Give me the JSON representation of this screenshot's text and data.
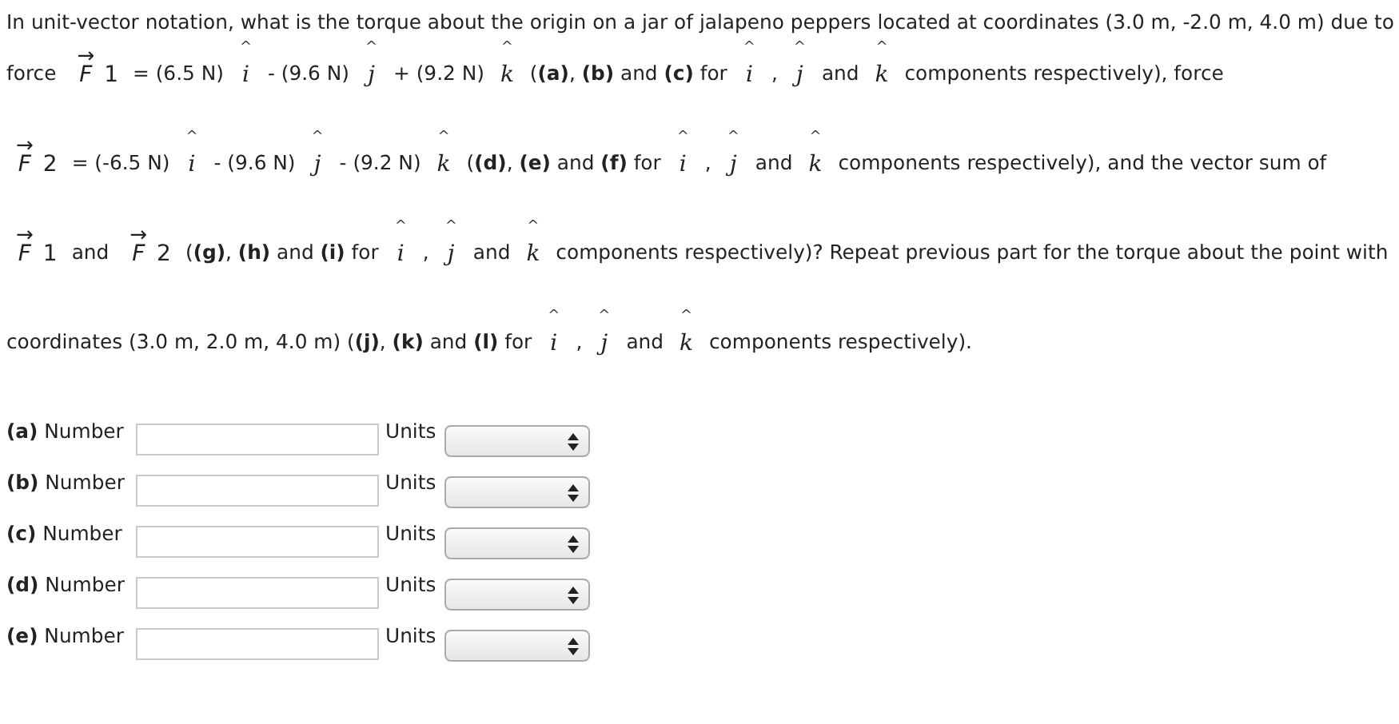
{
  "question": {
    "lines": [
      [
        {
          "kind": "text",
          "text": "In unit-vector notation, what is the torque about the origin on a jar of jalapeno peppers located at coordinates (3.0 m, -2.0 m, 4.0 m) due to"
        }
      ],
      [
        {
          "kind": "text",
          "text": "force"
        },
        {
          "kind": "vector",
          "arrow": "→",
          "symbol": "F",
          "index": "1"
        },
        {
          "kind": "text",
          "text": "= (6.5 N)"
        },
        {
          "kind": "unit_vector",
          "hat": "^",
          "symbol": "i"
        },
        {
          "kind": "text",
          "text": "- (9.6 N)"
        },
        {
          "kind": "unit_vector",
          "hat": "^",
          "symbol": "j"
        },
        {
          "kind": "text",
          "text": "+ (9.2 N)"
        },
        {
          "kind": "unit_vector",
          "hat": "^",
          "symbol": "k"
        },
        {
          "kind": "text",
          "text": "(**(a)**, **(b)** and **(c)** for"
        },
        {
          "kind": "unit_vector",
          "hat": "^",
          "symbol": "i"
        },
        {
          "kind": "text",
          "text": ","
        },
        {
          "kind": "unit_vector",
          "hat": "^",
          "symbol": "j"
        },
        {
          "kind": "text",
          "text": "and"
        },
        {
          "kind": "unit_vector",
          "hat": "^",
          "symbol": "k"
        },
        {
          "kind": "text",
          "text": "components respectively), force"
        }
      ],
      [
        {
          "kind": "vector",
          "arrow": "→",
          "symbol": "F",
          "index": "2"
        },
        {
          "kind": "text",
          "text": "= (-6.5 N)"
        },
        {
          "kind": "unit_vector",
          "hat": "^",
          "symbol": "i"
        },
        {
          "kind": "text",
          "text": "- (9.6 N)"
        },
        {
          "kind": "unit_vector",
          "hat": "^",
          "symbol": "j"
        },
        {
          "kind": "text",
          "text": "- (9.2 N)"
        },
        {
          "kind": "unit_vector",
          "hat": "^",
          "symbol": "k"
        },
        {
          "kind": "text",
          "text": "(**(d)**, **(e)** and **(f)** for"
        },
        {
          "kind": "unit_vector",
          "hat": "^",
          "symbol": "i"
        },
        {
          "kind": "text",
          "text": ","
        },
        {
          "kind": "unit_vector",
          "hat": "^",
          "symbol": "j"
        },
        {
          "kind": "text",
          "text": "and"
        },
        {
          "kind": "unit_vector",
          "hat": "^",
          "symbol": "k"
        },
        {
          "kind": "text",
          "text": "components respectively), and the vector sum of"
        }
      ],
      [
        {
          "kind": "vector",
          "arrow": "→",
          "symbol": "F",
          "index": "1"
        },
        {
          "kind": "text",
          "text": "and"
        },
        {
          "kind": "vector",
          "arrow": "→",
          "symbol": "F",
          "index": "2"
        },
        {
          "kind": "text",
          "text": "(**(g)**, **(h)** and **(i)** for"
        },
        {
          "kind": "unit_vector",
          "hat": "^",
          "symbol": "i"
        },
        {
          "kind": "text",
          "text": ","
        },
        {
          "kind": "unit_vector",
          "hat": "^",
          "symbol": "j"
        },
        {
          "kind": "text",
          "text": "and"
        },
        {
          "kind": "unit_vector",
          "hat": "^",
          "symbol": "k"
        },
        {
          "kind": "text",
          "text": "components respectively)? Repeat previous part for the torque about the point with"
        }
      ],
      [
        {
          "kind": "text",
          "text": "coordinates (3.0 m, 2.0 m, 4.0 m) (**(j)**, **(k)** and **(l)** for"
        },
        {
          "kind": "unit_vector",
          "hat": "^",
          "symbol": "i"
        },
        {
          "kind": "text",
          "text": ","
        },
        {
          "kind": "unit_vector",
          "hat": "^",
          "symbol": "j"
        },
        {
          "kind": "text",
          "text": "and"
        },
        {
          "kind": "unit_vector",
          "hat": "^",
          "symbol": "k"
        },
        {
          "kind": "text",
          "text": "components respectively)."
        }
      ]
    ]
  },
  "answers": [
    {
      "part": "(a)",
      "label": "Number",
      "units_label": "Units"
    },
    {
      "part": "(b)",
      "label": "Number",
      "units_label": "Units"
    },
    {
      "part": "(c)",
      "label": "Number",
      "units_label": "Units"
    },
    {
      "part": "(d)",
      "label": "Number",
      "units_label": "Units"
    },
    {
      "part": "(e)",
      "label": "Number",
      "units_label": "Units"
    }
  ]
}
